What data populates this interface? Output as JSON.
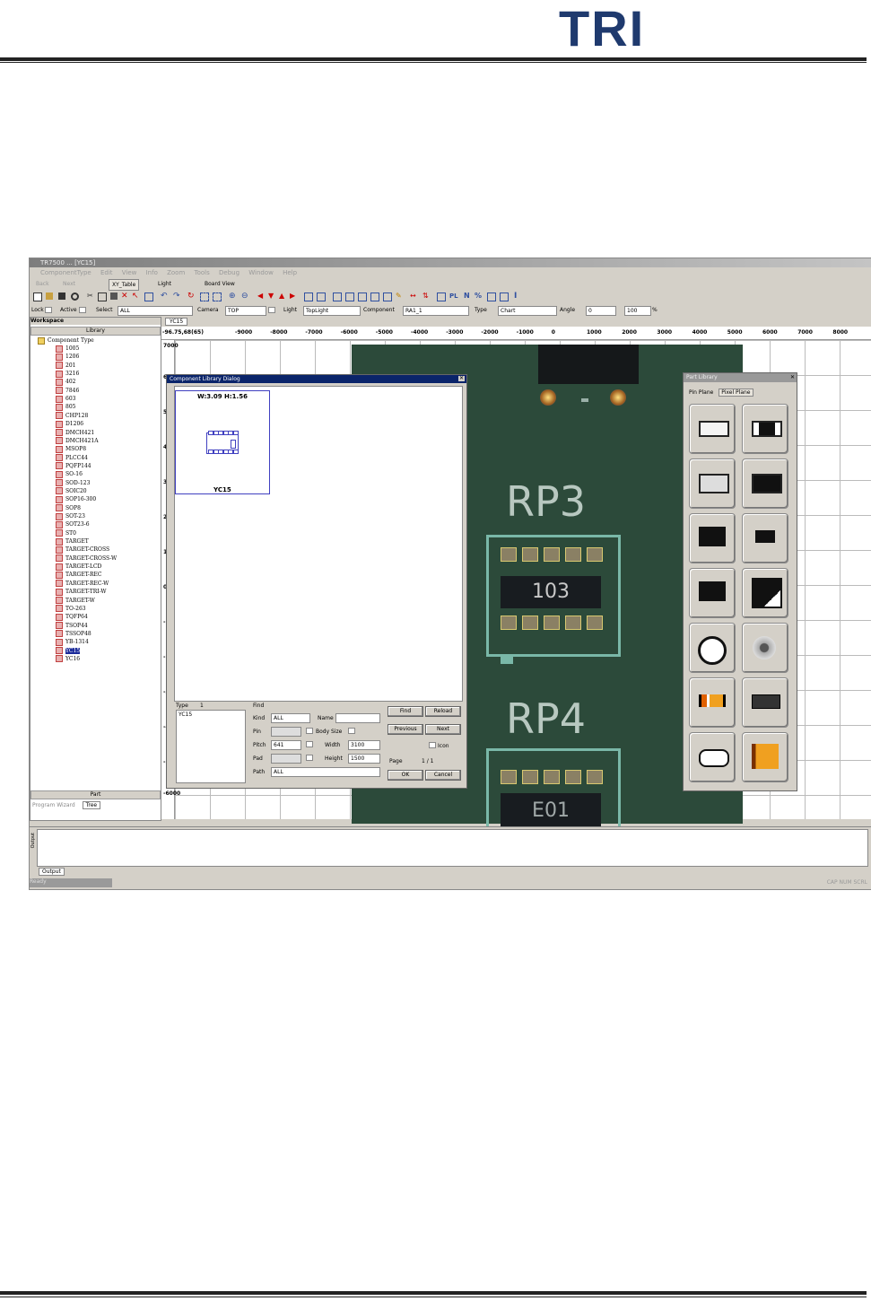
{
  "header": {
    "logo_text": "TRI"
  },
  "screenshot": {
    "window_title": "TR7500 ... [YC15]",
    "menu": [
      "ComponentType",
      "Edit",
      "View",
      "Info",
      "Zoom",
      "Tools",
      "Debug",
      "Window",
      "Help"
    ],
    "toolbar1": {
      "back": "Back",
      "next": "Next",
      "xy_table": "XY_Table",
      "light": "Light",
      "board_view": "Board View"
    },
    "toolbar3": {
      "lock_label": "Lock",
      "active_label": "Active",
      "select_label": "Select",
      "select_value": "ALL",
      "camera_label": "Camera",
      "camera_value": "TOP",
      "light_label": "Light",
      "light_value": "TopLight",
      "component_label": "Component",
      "component_value": "RA1_1",
      "type_label": "Type",
      "type_value": "Chart",
      "angle_label": "Angle",
      "angle_value": "0",
      "scale_value": "100",
      "pct": "%"
    },
    "workspace": {
      "title": "Workspace",
      "library": "Library",
      "root": "Component Type",
      "items": [
        "1005",
        "1206",
        "201",
        "3216",
        "402",
        "7846",
        "603",
        "805",
        "CHP128",
        "D1206",
        "DMCH421",
        "DMCH421A",
        "MSOP8",
        "PLCC44",
        "PQFP144",
        "SO-16",
        "SOD-123",
        "SOIC20",
        "SOP16-300",
        "SOP8",
        "SOT-23",
        "SOT23-6",
        "ST0",
        "TARGET",
        "TARGET-CROSS",
        "TARGET-CROSS-W",
        "TARGET-LCD",
        "TARGET-REC",
        "TARGET-REC-W",
        "TARGET-TRI-W",
        "TARGET-W",
        "TO-263",
        "TQFP64",
        "TSOP44",
        "TSSOP48",
        "YB-1314",
        "YC15",
        "YC16"
      ],
      "selected": "YC15",
      "footer": "Part",
      "tabs": [
        "Program Wizard",
        "Tree"
      ]
    },
    "view": {
      "tab": "YC15",
      "coord_readout": "-96.75,68(65)",
      "x_ticks": [
        "-9000",
        "-8000",
        "-7000",
        "-6000",
        "-5000",
        "-4000",
        "-3000",
        "-2000",
        "-1000",
        "0",
        "1000",
        "2000",
        "3000",
        "4000",
        "5000",
        "6000",
        "7000",
        "8000"
      ],
      "y_top": "7000",
      "y_ticks": [
        "6",
        "5",
        "4",
        "3",
        "2",
        "1",
        "0",
        "-1",
        "-2",
        "-3",
        "-4",
        "-5"
      ],
      "y_bottom": "-6000",
      "silkscreen": [
        "RP3",
        "RP4"
      ],
      "chip_marks": [
        "103",
        "E01"
      ]
    },
    "dialog": {
      "title": "Component Library Dialog",
      "dims": "W:3.09 H:1.56",
      "name": "YC15",
      "type_label": "Type",
      "type_count": "1",
      "type_value": "YC15",
      "find_label": "Find",
      "kind_label": "Kind",
      "kind_value": "ALL",
      "name_label": "Name",
      "pin_label": "Pin",
      "body_size_label": "Body Size",
      "pitch_label": "Pitch",
      "pitch_value": "641",
      "width_label": "Width",
      "width_value": "3100",
      "pad_label": "Pad",
      "height_label": "Height",
      "height_value": "1500",
      "path_label": "Path",
      "path_value": "ALL",
      "buttons": {
        "find": "Find",
        "reload": "Reload",
        "previous": "Previous",
        "next": "Next",
        "icon": "Icon",
        "ok": "OK",
        "cancel": "Cancel"
      },
      "page_label": "Page",
      "page_value": "1 / 1"
    },
    "palette": {
      "title": "Part Library",
      "tabs": [
        "Pin Plane",
        "Pixel Plane"
      ]
    },
    "output": {
      "label": "Output",
      "tab": "Output"
    },
    "status": {
      "left": "Ready",
      "right": "CAP NUM SCRL"
    }
  }
}
